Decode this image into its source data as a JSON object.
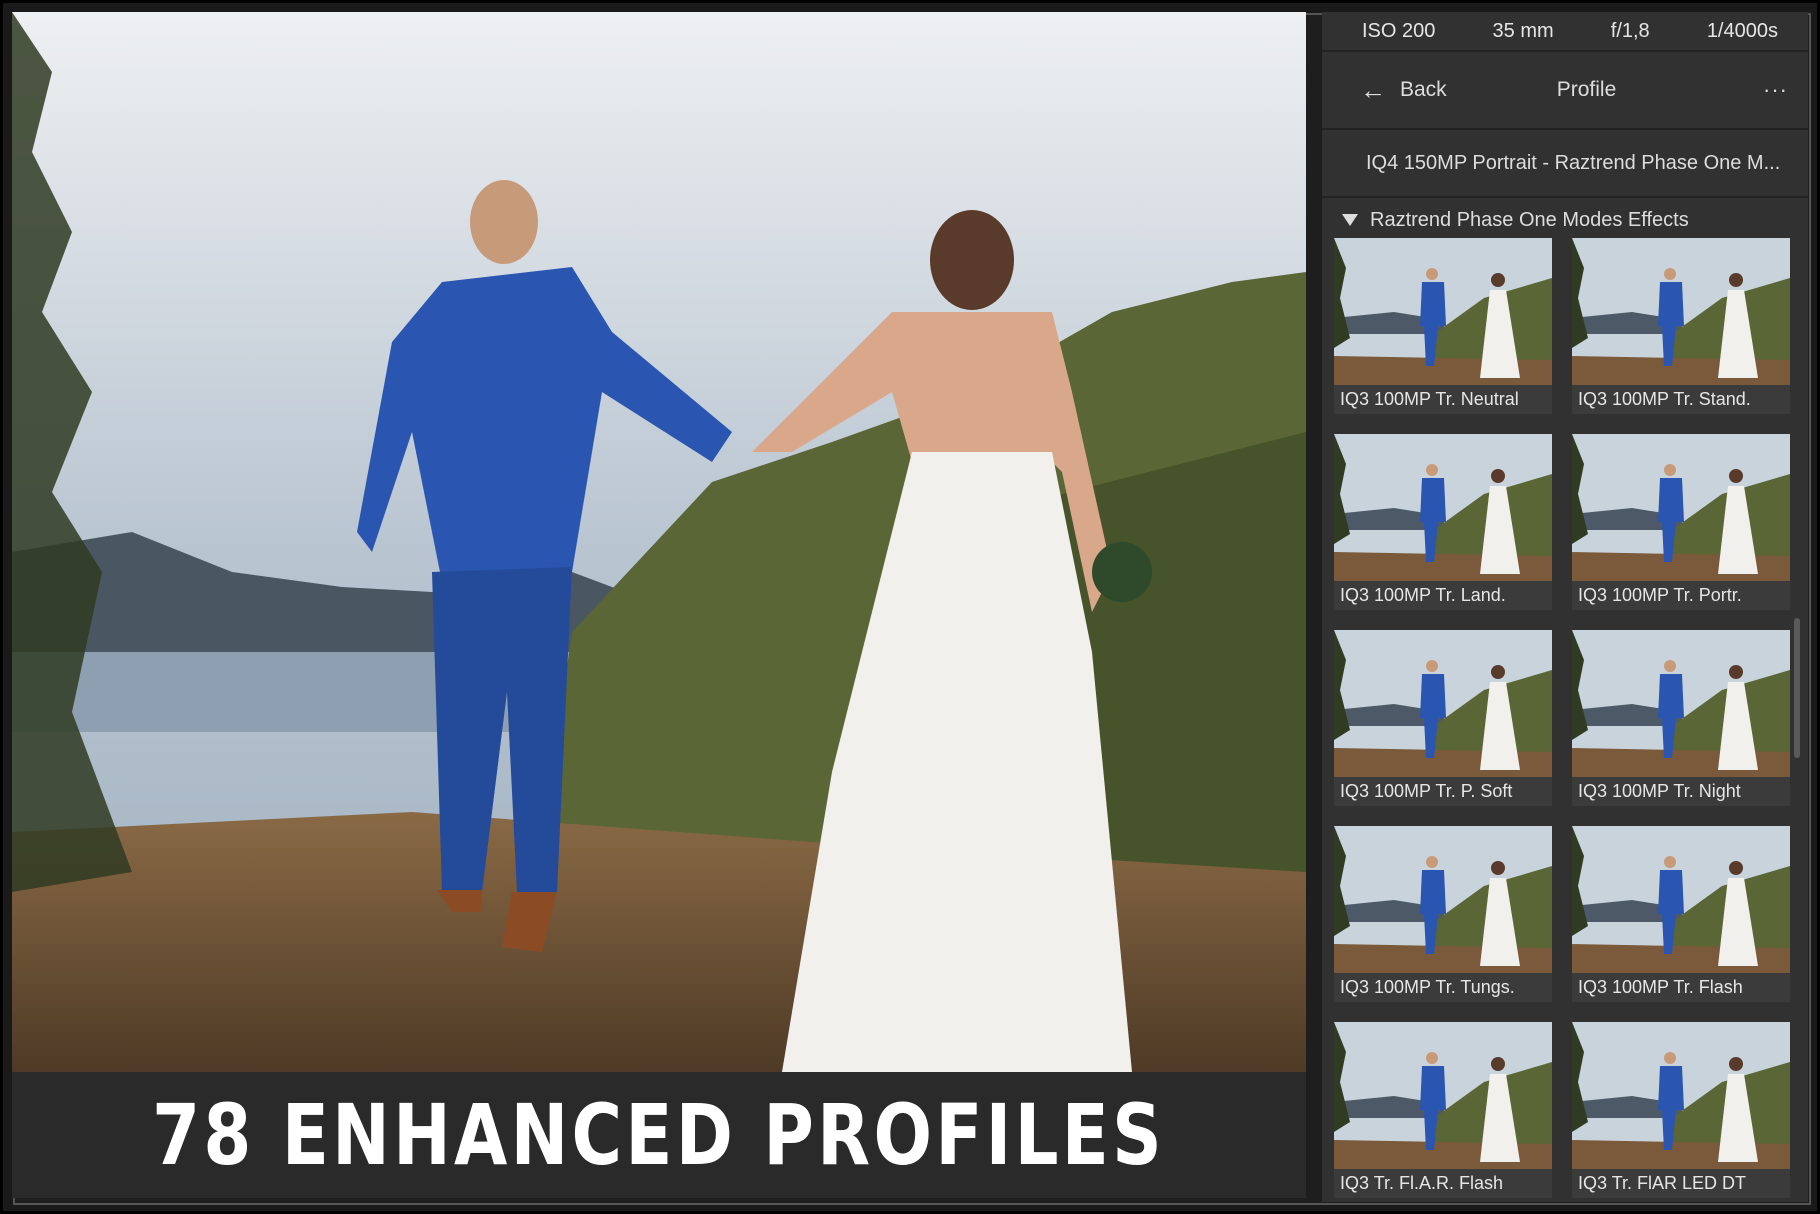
{
  "banner": {
    "text": "78 ENHANCED PROFILES"
  },
  "exif": {
    "iso": "ISO 200",
    "focal": "35 mm",
    "aperture": "f/1,8",
    "shutter": "1/4000s"
  },
  "nav": {
    "back_label": "Back",
    "title": "Profile",
    "more_label": "···"
  },
  "profile": {
    "name": "IQ4 150MP Portrait - Raztrend Phase One M..."
  },
  "group": {
    "label": "Raztrend Phase One Modes Effects"
  },
  "thumbnails": [
    {
      "label": "IQ3 100MP Tr. Neutral"
    },
    {
      "label": "IQ3 100MP Tr. Stand."
    },
    {
      "label": "IQ3 100MP Tr. Land."
    },
    {
      "label": "IQ3 100MP Tr. Portr."
    },
    {
      "label": "IQ3 100MP Tr. P. Soft"
    },
    {
      "label": "IQ3 100MP Tr. Night"
    },
    {
      "label": "IQ3 100MP Tr. Tungs."
    },
    {
      "label": "IQ3 100MP Tr. Flash"
    },
    {
      "label": "IQ3 Tr. Fl.A.R. Flash"
    },
    {
      "label": "IQ3 Tr. FlAR LED DT"
    }
  ],
  "colors": {
    "panel": "#313131",
    "suit": "#2a55b0",
    "dress": "#f2f0ec",
    "sky": "#c9d3dc",
    "hill": "#5d6b3a",
    "ground": "#7a5a3a"
  }
}
